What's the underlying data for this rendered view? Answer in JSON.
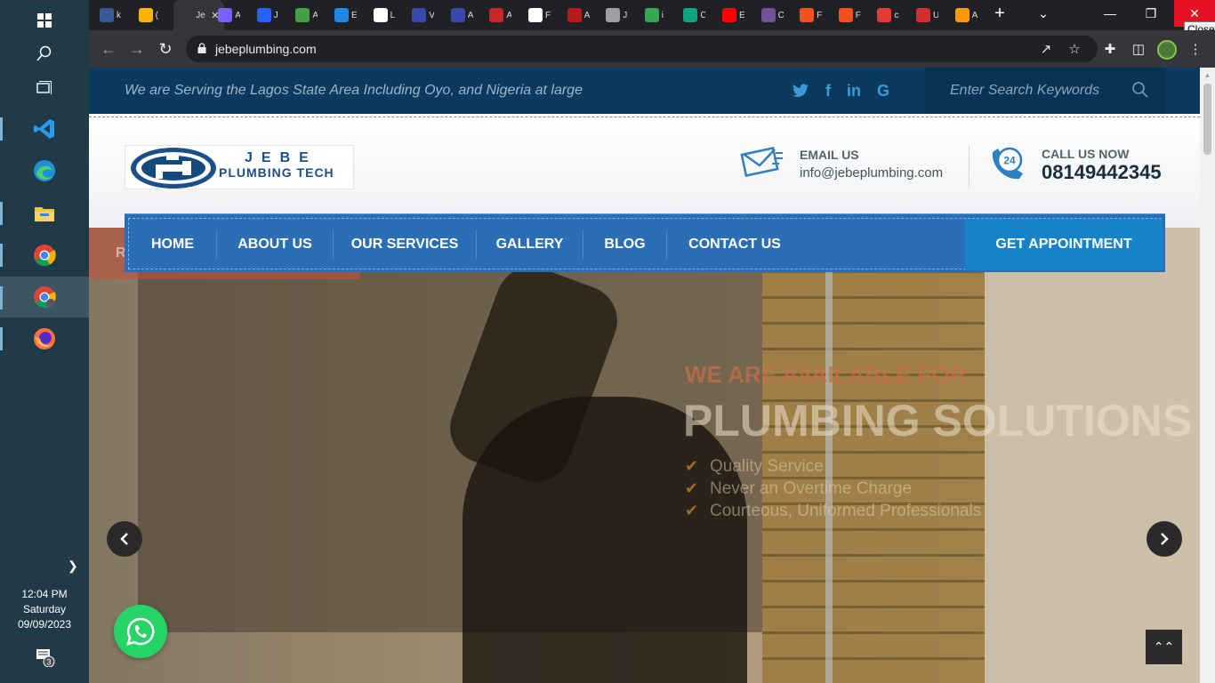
{
  "taskbar": {
    "apps": [
      {
        "name": "start",
        "icon": "windows-icon"
      },
      {
        "name": "search",
        "icon": "search-icon"
      },
      {
        "name": "task-view",
        "icon": "task-view-icon"
      },
      {
        "name": "vscode",
        "icon": "vscode-icon"
      },
      {
        "name": "edge",
        "icon": "edge-icon"
      },
      {
        "name": "file-explorer",
        "icon": "folder-icon"
      },
      {
        "name": "chrome",
        "icon": "chrome-icon"
      },
      {
        "name": "chrome-profile",
        "icon": "chrome-icon"
      },
      {
        "name": "firefox",
        "icon": "firefox-icon"
      }
    ],
    "clock": {
      "time": "12:04 PM",
      "day": "Saturday",
      "date": "09/09/2023"
    },
    "notification_count": "3"
  },
  "browser": {
    "tooltip": "Close",
    "url": "jebeplumbing.com",
    "active_tab_label": "Je",
    "tabs": [
      {
        "letter": "k",
        "color": "#3b5998"
      },
      {
        "letter": "(",
        "color": "#ffb300"
      },
      {
        "letter": "Je",
        "color": "#35363a",
        "active": true
      },
      {
        "letter": "A",
        "color": "#7b61ff"
      },
      {
        "letter": "J",
        "color": "#2962ff"
      },
      {
        "letter": "A",
        "color": "#43a047"
      },
      {
        "letter": "E",
        "color": "#1e88e5"
      },
      {
        "letter": "L",
        "color": "#ffffff"
      },
      {
        "letter": "V",
        "color": "#3949ab"
      },
      {
        "letter": "A",
        "color": "#3949ab"
      },
      {
        "letter": "A",
        "color": "#c62828"
      },
      {
        "letter": "F",
        "color": "#ffffff"
      },
      {
        "letter": "A",
        "color": "#b71c1c"
      },
      {
        "letter": "J",
        "color": "#9e9e9e"
      },
      {
        "letter": "i",
        "color": "#34a853"
      },
      {
        "letter": "C",
        "color": "#10a37f"
      },
      {
        "letter": "E",
        "color": "#ff0000"
      },
      {
        "letter": "C",
        "color": "#6e5494"
      },
      {
        "letter": "F",
        "color": "#f4511e"
      },
      {
        "letter": "F",
        "color": "#f4511e"
      },
      {
        "letter": "c",
        "color": "#e53935"
      },
      {
        "letter": "U",
        "color": "#d32f2f"
      },
      {
        "letter": "A",
        "color": "#ff9900"
      }
    ]
  },
  "site": {
    "tagline": "We are Serving the Lagos State Area Including Oyo, and Nigeria at large",
    "social": [
      "twitter-icon",
      "facebook-icon",
      "linkedin-icon",
      "google-icon"
    ],
    "social_glyphs": [
      "🐦",
      "f",
      "in",
      "G"
    ],
    "search_placeholder": "Enter Search Keywords",
    "logo": {
      "line1": "JEBE",
      "line2": "PLUMBING TECH"
    },
    "email": {
      "label": "EMAIL US",
      "value": "info@jebeplumbing.com"
    },
    "phone": {
      "label": "CALL US NOW",
      "value": "08149442345",
      "badge": "24"
    },
    "nav": {
      "items": [
        "HOME",
        "ABOUT US",
        "OUR SERVICES",
        "GALLERY",
        "BLOG",
        "CONTACT US"
      ],
      "cta": "GET APPOINTMENT"
    },
    "hero": {
      "strip_text": "R",
      "subtitle": "WE ARE AVAILABLE FOR",
      "title": "PLUMBING SOLUTIONS",
      "features": [
        "Quality Service",
        "Never an Overtime Charge",
        "Courteous, Uniformed Professionals"
      ]
    }
  },
  "colors": {
    "topbar": "#0a3a5f",
    "nav": "#2a6fb6",
    "cta": "#1683c9",
    "whatsapp": "#25d366",
    "brand": "#1b4f86"
  }
}
